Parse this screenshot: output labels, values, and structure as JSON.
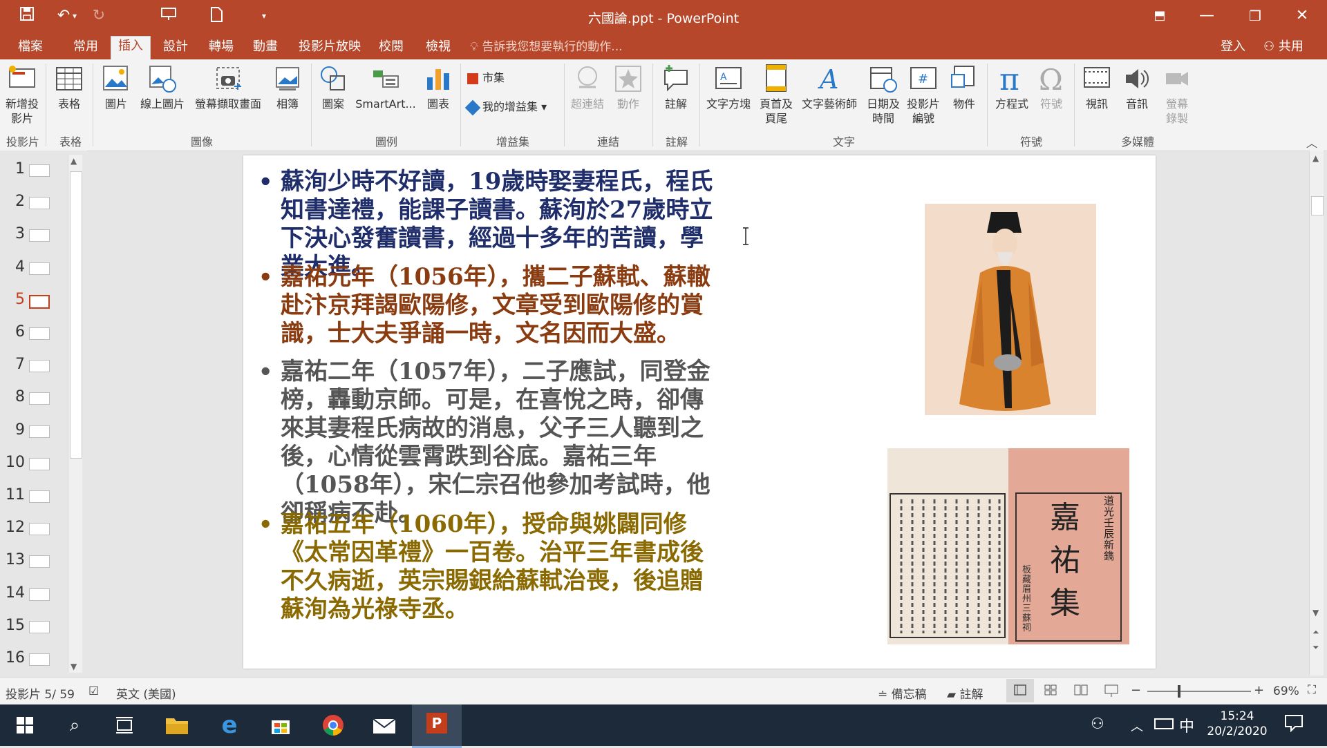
{
  "window": {
    "title": "六國論.ppt - PowerPoint"
  },
  "tabs": [
    {
      "label": "檔案"
    },
    {
      "label": "常用"
    },
    {
      "label": "插入"
    },
    {
      "label": "設計"
    },
    {
      "label": "轉場"
    },
    {
      "label": "動畫"
    },
    {
      "label": "投影片放映"
    },
    {
      "label": "校閱"
    },
    {
      "label": "檢視"
    }
  ],
  "tell_me": "告訴我您想要執行的動作...",
  "account": {
    "signin": "登入",
    "share": "共用"
  },
  "ribbon": {
    "buttons": {
      "new_slide": "新增投影片",
      "table": "表格",
      "picture": "圖片",
      "online_picture": "線上圖片",
      "screenshot": "螢幕擷取畫面",
      "album": "相簿",
      "shapes": "圖案",
      "smartart": "SmartArt...",
      "chart": "圖表",
      "store": "市集",
      "my_addins": "我的增益集",
      "hyperlink": "超連結",
      "action": "動作",
      "comment": "註解",
      "textbox": "文字方塊",
      "header_footer": "頁首及頁尾",
      "wordart": "文字藝術師",
      "datetime": "日期及時間",
      "slide_number": "投影片編號",
      "object": "物件",
      "equation": "方程式",
      "symbol": "符號",
      "video": "視訊",
      "audio": "音訊",
      "screen_recording": "螢幕錄製"
    },
    "groups": {
      "slides": "投影片",
      "tables": "表格",
      "images": "圖像",
      "illustrations": "圖例",
      "addins": "增益集",
      "links": "連結",
      "comments": "註解",
      "text": "文字",
      "symbols": "符號",
      "media": "多媒體"
    }
  },
  "thumbnails": [
    "1",
    "2",
    "3",
    "4",
    "5",
    "6",
    "7",
    "8",
    "9",
    "10",
    "11",
    "12",
    "13",
    "14",
    "15",
    "16"
  ],
  "current_slide_index": 5,
  "slide": {
    "bullets": [
      {
        "text": "蘇洵少時不好讀，19歲時娶妻程氏，程氏知書達禮，能課子讀書。蘇洵於27歲時立下決心發奮讀書，經過十多年的苦讀，學業大進。",
        "color": "#1f2d6b"
      },
      {
        "text": "嘉祐元年（1056年），攜二子蘇軾、蘇轍赴汴京拜謁歐陽修，文章受到歐陽修的賞識，士大夫爭誦一時，文名因而大盛。",
        "color": "#8a3c10"
      },
      {
        "text": "嘉祐二年（1057年），二子應試，同登金榜，轟動京師。可是，在喜悅之時，卻傳來其妻程氏病故的消息，父子三人聽到之後，心情從雲霄跌到谷底。嘉祐三年（1058年），宋仁宗召他參加考試時，他卻稱病不赴。",
        "color": "#555555"
      },
      {
        "text": "嘉祐五年（1060年），授命與姚闢同修《太常因革禮》一百卷。治平三年書成後不久病逝，英宗賜銀給蘇軾治喪，後追贈蘇洵為光祿寺丞。",
        "color": "#8a6a00"
      }
    ],
    "book_cover_text": {
      "top_right": "道光壬辰新鐫",
      "title": "嘉祐集",
      "side_note": "板藏眉州三蘇祠"
    }
  },
  "statusbar": {
    "slide_info": "投影片 5/ 59",
    "language": "英文 (美國)",
    "notes": "備忘稿",
    "comments": "註解",
    "zoom": "69%"
  },
  "taskbar": {
    "time": "15:24",
    "date": "20/2/2020",
    "ime": "中"
  }
}
